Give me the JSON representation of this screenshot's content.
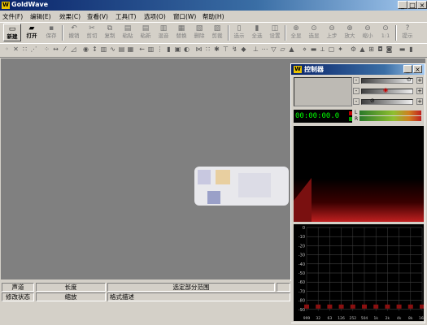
{
  "app": {
    "title": "GoldWave",
    "logo_letter": "W"
  },
  "window_controls": {
    "minimize": "_",
    "maximize": "□",
    "close": "×"
  },
  "menu": [
    "文件(F)",
    "编辑(E)",
    "效果(C)",
    "查看(V)",
    "工具(T)",
    "选项(O)",
    "窗口(W)",
    "帮助(H)"
  ],
  "toolbar1": [
    {
      "label": "新建",
      "enabled": true
    },
    {
      "label": "打开",
      "enabled": true
    },
    {
      "label": "保存",
      "enabled": false
    },
    {
      "label": "撤销",
      "enabled": false
    },
    {
      "label": "剪切",
      "enabled": false
    },
    {
      "label": "复制",
      "enabled": false
    },
    {
      "label": "粘贴",
      "enabled": false
    },
    {
      "label": "粘新",
      "enabled": false
    },
    {
      "label": "混音",
      "enabled": false
    },
    {
      "label": "替换",
      "enabled": false
    },
    {
      "label": "删除",
      "enabled": false
    },
    {
      "label": "剪裁",
      "enabled": false
    },
    {
      "label": "选示",
      "enabled": false
    },
    {
      "label": "全选",
      "enabled": false
    },
    {
      "label": "设置",
      "enabled": false
    },
    {
      "label": "全显",
      "enabled": false
    },
    {
      "label": "选显",
      "enabled": false
    },
    {
      "label": "上步",
      "enabled": false
    },
    {
      "label": "放大",
      "enabled": false
    },
    {
      "label": "缩小",
      "enabled": false
    },
    {
      "label": "1:1",
      "enabled": false
    },
    {
      "label": "提示",
      "enabled": false
    }
  ],
  "controller": {
    "title": "控制器",
    "timer": "00:00:00.0",
    "lr_labels": [
      "L",
      "R"
    ],
    "slider_buttons": [
      "-",
      "+"
    ],
    "spectrum_y_ticks": [
      "0",
      "-10",
      "-20",
      "-30",
      "-40",
      "-50",
      "-60",
      "-70",
      "-80",
      "-90"
    ],
    "spectrum_x_ticks": [
      "999",
      "32",
      "63",
      "126",
      "252",
      "504",
      "1k",
      "2k",
      "4k",
      "8k",
      "16k"
    ]
  },
  "status": {
    "row1": [
      "声道",
      "长度",
      "选定部分范围",
      ""
    ],
    "row2": [
      "修改状态",
      "缩放",
      "格式描述"
    ]
  }
}
